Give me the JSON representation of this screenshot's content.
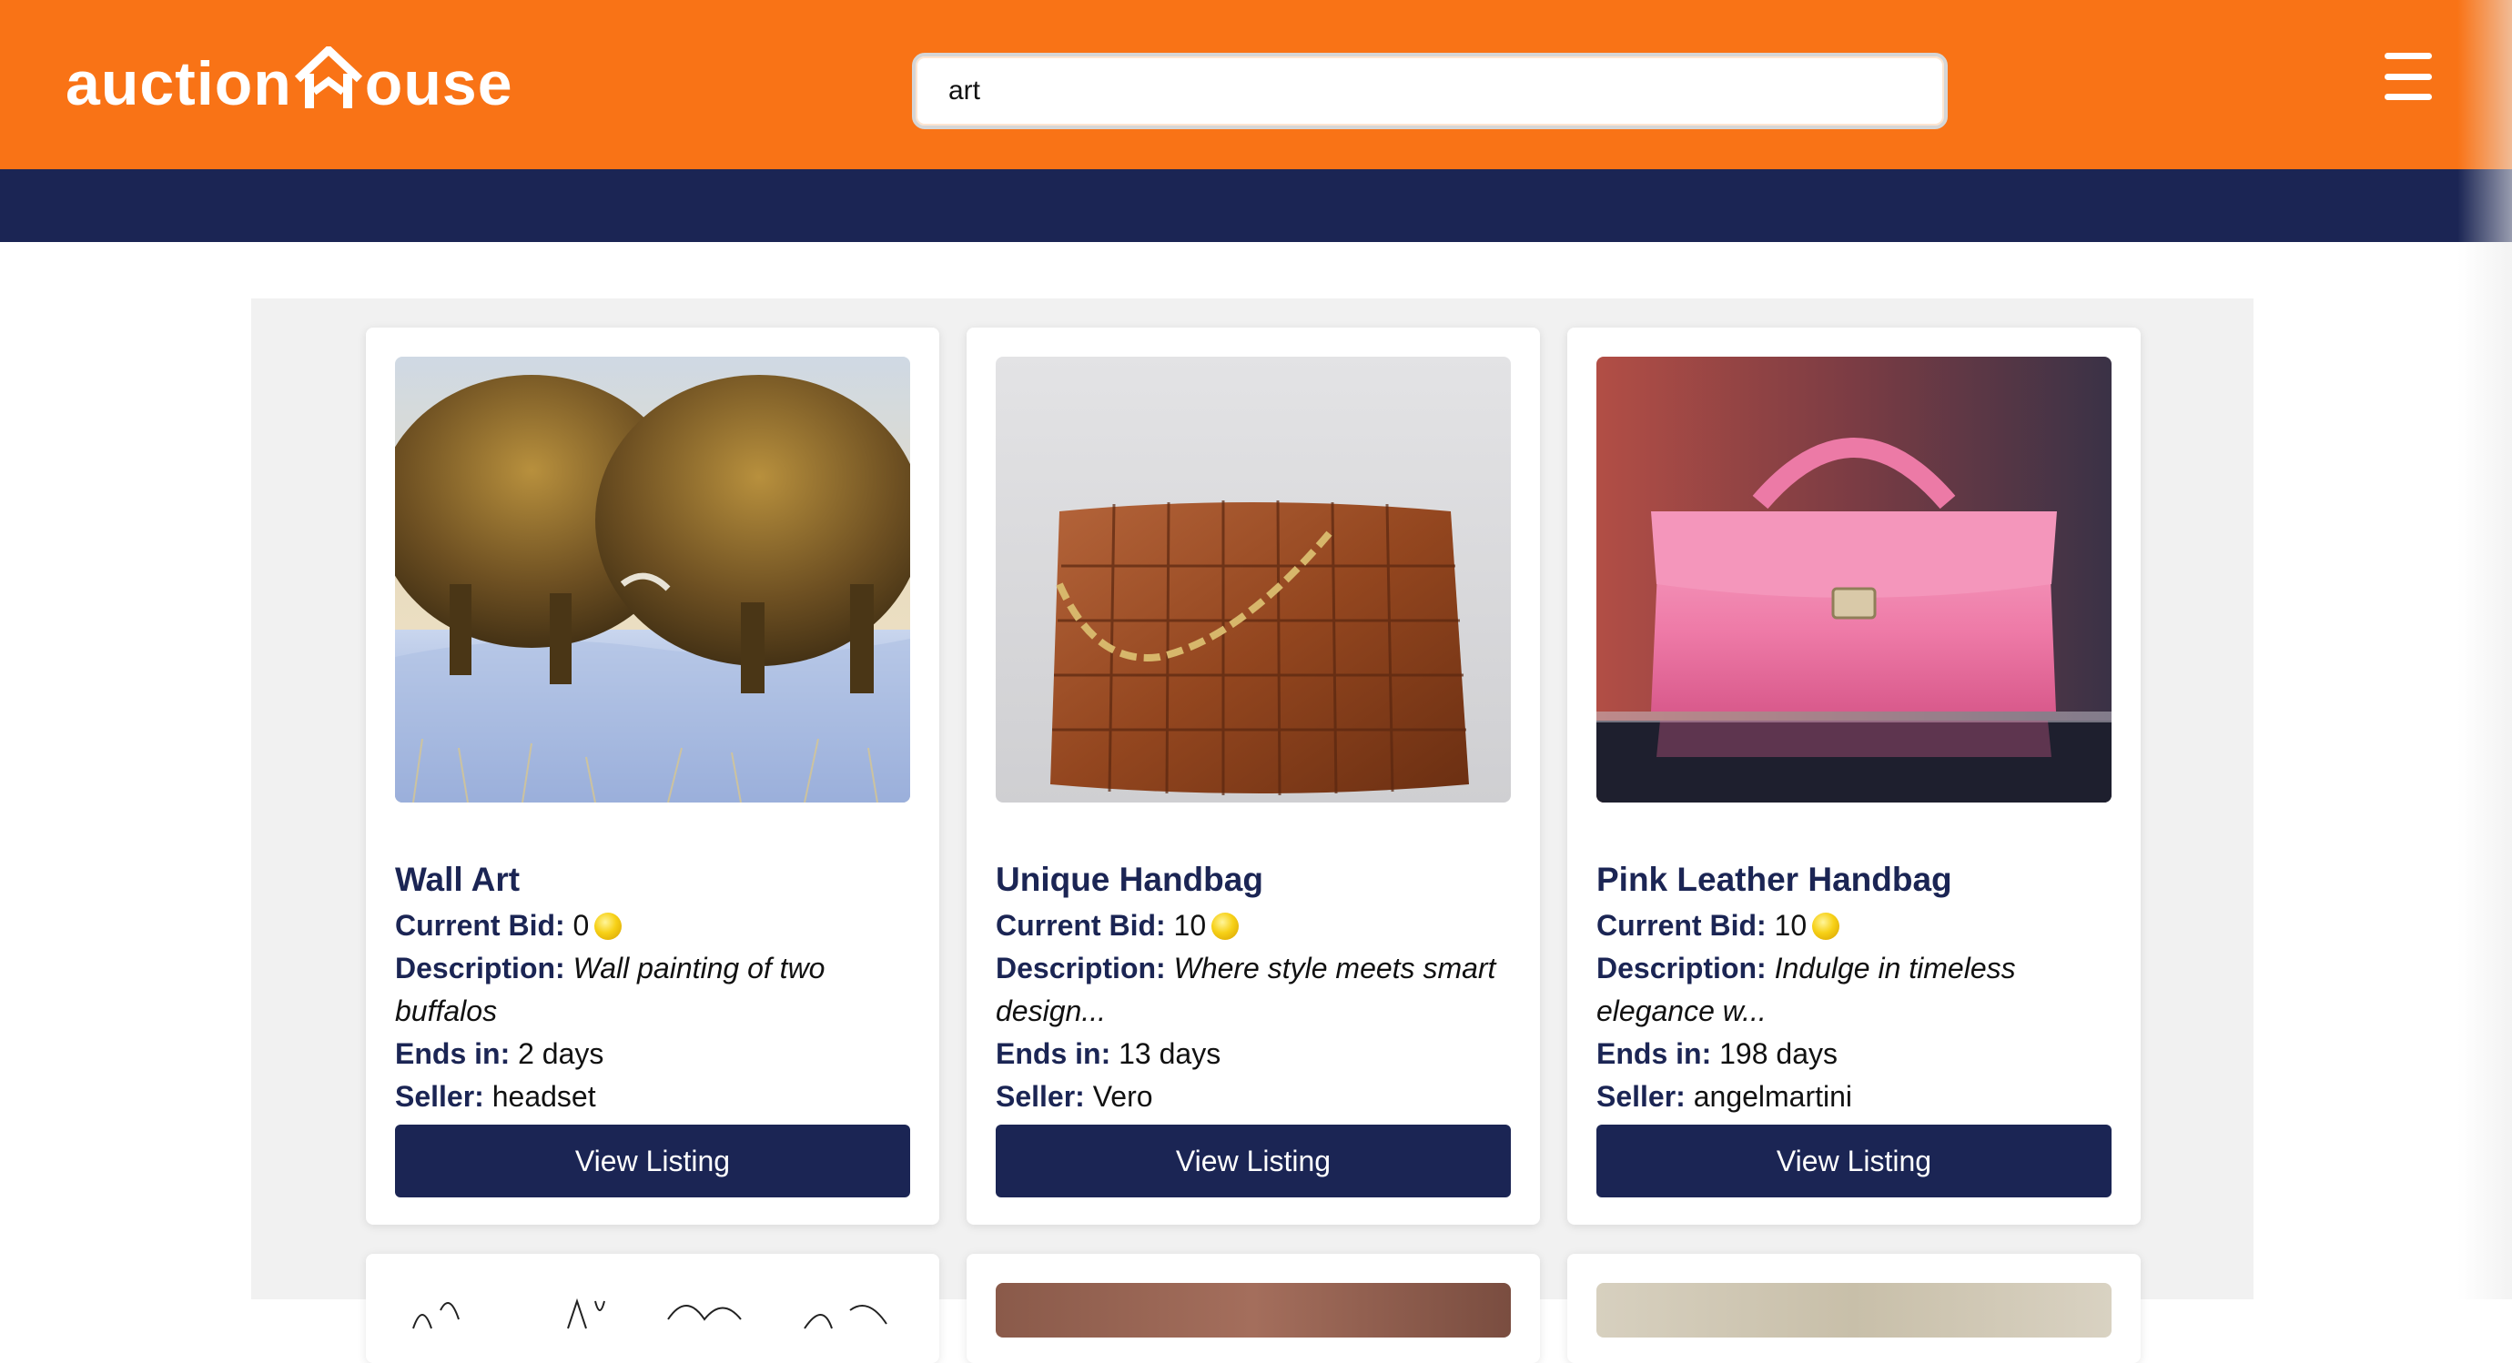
{
  "header": {
    "logo_prefix": "auction",
    "logo_suffix": "ouse",
    "brand_color": "#f97316",
    "nav_color": "#1b2554",
    "menu_icon": "hamburger-icon"
  },
  "search": {
    "value": "art"
  },
  "listings": [
    {
      "title": "Wall Art",
      "bid_label": "Current Bid:",
      "bid_value": "0",
      "desc_label": "Description:",
      "desc_line1": "Wall painting of two",
      "desc_line2": "buffalos",
      "ends_label": "Ends in:",
      "ends_value": "2 days",
      "seller_label": "Seller:",
      "seller_value": "headset",
      "button": "View Listing",
      "image": "bison-photo"
    },
    {
      "title": "Unique Handbag",
      "bid_label": "Current Bid:",
      "bid_value": "10",
      "desc_label": "Description:",
      "desc_line1": "Where style meets smart",
      "desc_line2": "design...",
      "ends_label": "Ends in:",
      "ends_value": "13 days",
      "seller_label": "Seller:",
      "seller_value": "Vero",
      "button": "View Listing",
      "image": "brown-woven-handbag-photo"
    },
    {
      "title": "Pink Leather Handbag",
      "bid_label": "Current Bid:",
      "bid_value": "10",
      "desc_label": "Description:",
      "desc_line1": "Indulge in timeless",
      "desc_line2": "elegance w...",
      "ends_label": "Ends in:",
      "ends_value": "198 days",
      "seller_label": "Seller:",
      "seller_value": "angelmartini",
      "button": "View Listing",
      "image": "pink-handbag-photo"
    }
  ],
  "more_listings": [
    {
      "image": "line-drawing-photo"
    },
    {
      "image": "blurred-photo"
    },
    {
      "image": "shop-sign-photo"
    }
  ]
}
